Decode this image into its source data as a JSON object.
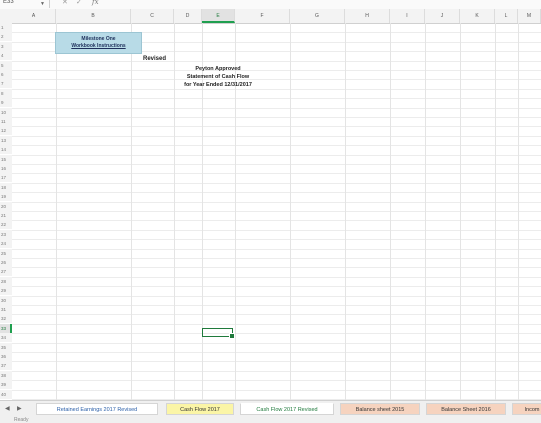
{
  "formula_bar": {
    "name_box": "E33",
    "cancel_icon": "x-icon",
    "confirm_icon": "check-icon",
    "fx_label": "fx",
    "formula_value": ""
  },
  "columns": [
    "A",
    "B",
    "C",
    "D",
    "E",
    "F",
    "G",
    "H",
    "I",
    "J",
    "K",
    "L",
    "M"
  ],
  "selected_column": "E",
  "rows": [
    "1",
    "2",
    "3",
    "4",
    "5",
    "6",
    "7",
    "8",
    "9",
    "10",
    "11",
    "12",
    "13",
    "14",
    "15",
    "16",
    "17",
    "18",
    "19",
    "20",
    "21",
    "22",
    "23",
    "24",
    "25",
    "26",
    "27",
    "28",
    "29",
    "30",
    "31",
    "32",
    "33",
    "34",
    "35",
    "36",
    "37",
    "38",
    "39",
    "40"
  ],
  "selected_row": "33",
  "cells": {
    "milestone_title": "Milestone One",
    "milestone_link": "Workbook Instructions",
    "revised": "Revised",
    "company": "Peyton Approved",
    "statement": "Statement of Cash Flow",
    "period": "for Year Ended 12/31/2017"
  },
  "tabs": [
    {
      "label": "Retained Earnings 2017 Revised",
      "bg": "#ffffff",
      "color": "#2b5fa8",
      "active": false
    },
    {
      "label": "Cash Flow 2017",
      "bg": "#fbf5a6",
      "color": "#333333",
      "active": false
    },
    {
      "label": "Cash Flow 2017 Revised",
      "bg": "#ffffff",
      "color": "#1f7a3c",
      "active": true
    },
    {
      "label": "Balance sheet 2015",
      "bg": "#f6d3bf",
      "color": "#333333",
      "active": false
    },
    {
      "label": "Balance Sheet 2016",
      "bg": "#f6d3bf",
      "color": "#333333",
      "active": false
    },
    {
      "label": "Incom",
      "bg": "#f6d3bf",
      "color": "#333333",
      "active": false
    }
  ],
  "status": "Ready",
  "colors": {
    "accent": "#1f7a3c",
    "milestone_bg": "#b8dbe7"
  }
}
